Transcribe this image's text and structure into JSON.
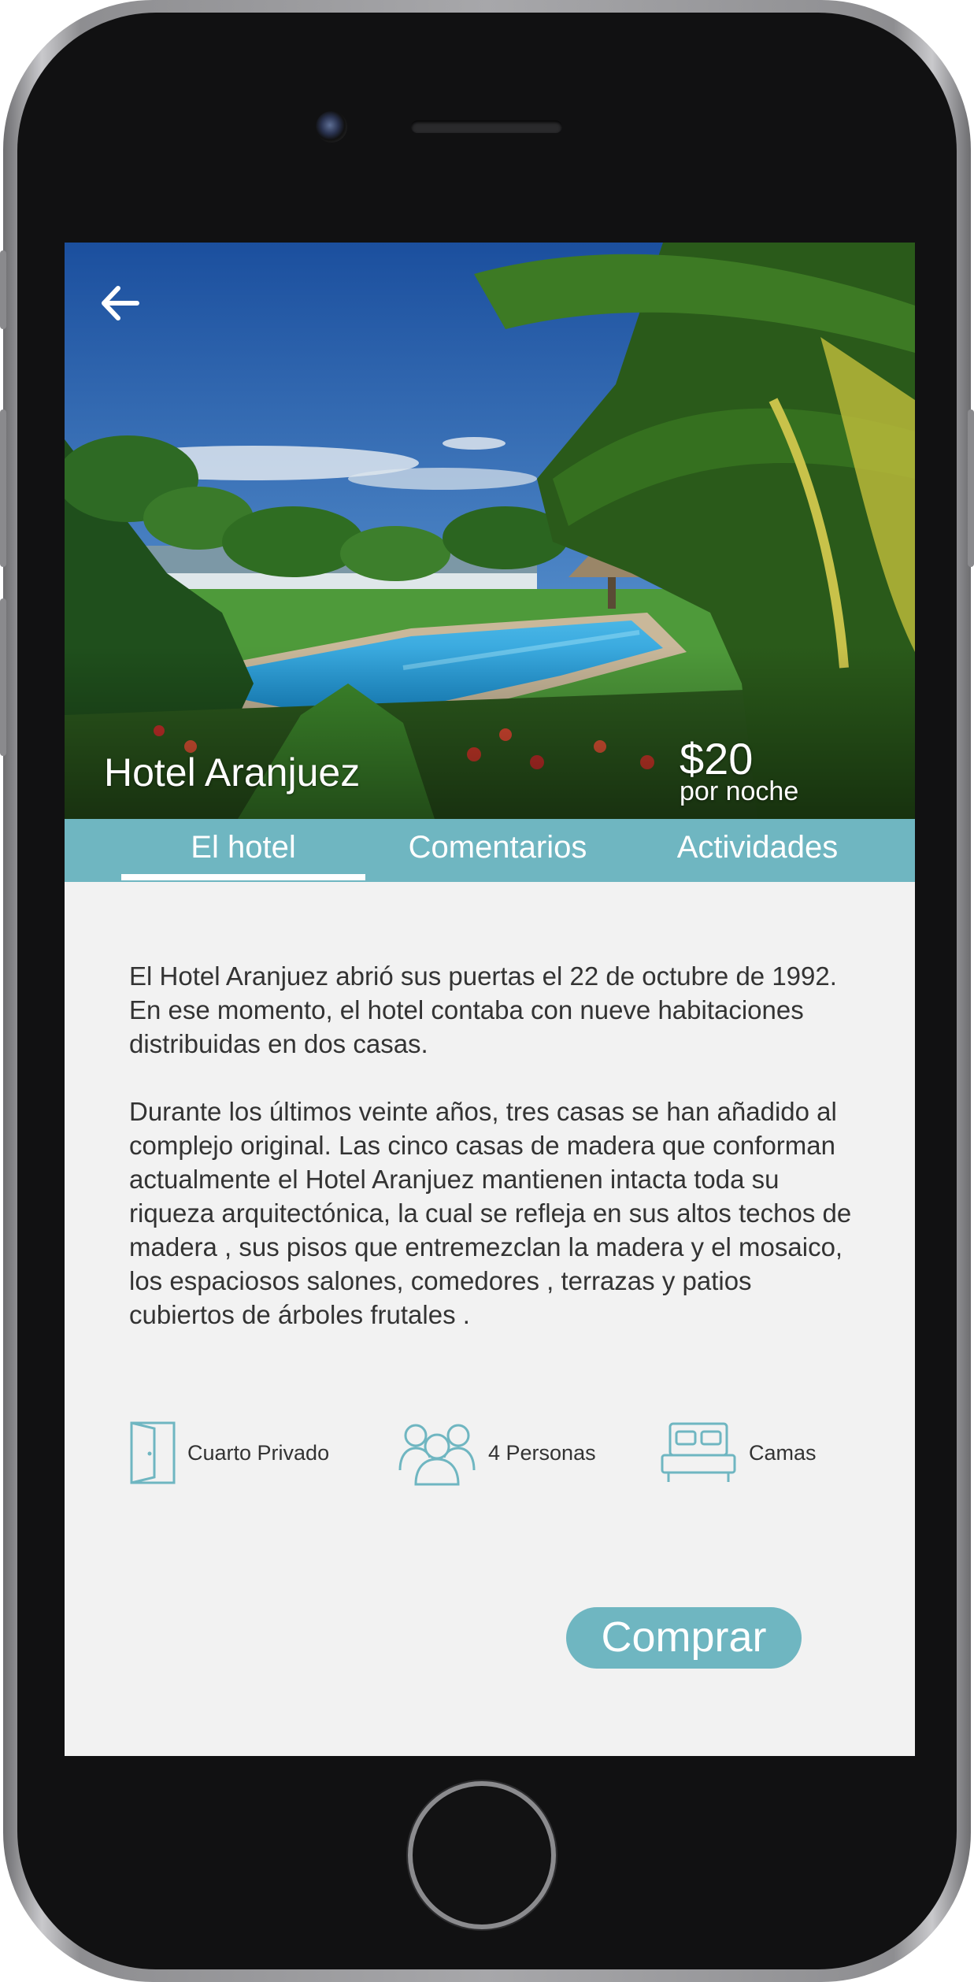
{
  "hotel": {
    "name": "Hotel Aranjuez",
    "price": "$20",
    "price_unit": "por noche"
  },
  "tabs": [
    {
      "label": "El hotel",
      "active": true
    },
    {
      "label": "Comentarios",
      "active": false
    },
    {
      "label": "Actividades",
      "active": false
    }
  ],
  "description": {
    "paragraph_1": "El Hotel Aranjuez abrió sus puertas el 22 de octubre de 1992. En ese momento, el hotel contaba con nueve habitaciones distribuidas en dos casas.",
    "paragraph_2": "Durante los últimos veinte años, tres casas se han añadido al complejo original. Las cinco casas de madera que conforman actualmente el Hotel Aranjuez mantienen intacta toda su riqueza arquitectónica, la cual se refleja en sus altos techos de madera , sus pisos que entremezclan la madera y el mosaico, los espaciosos salones, comedores , terrazas y patios cubiertos de árboles frutales ."
  },
  "features": [
    {
      "icon": "door-icon",
      "label": "Cuarto Privado"
    },
    {
      "icon": "people-icon",
      "label": "4 Personas"
    },
    {
      "icon": "bed-icon",
      "label": "Camas"
    }
  ],
  "buy_button": {
    "label": "Comprar"
  },
  "colors": {
    "accent": "#6fb6c1",
    "screen_background": "#f2f2f2",
    "text": "#333333",
    "phone_body": "#111112"
  }
}
